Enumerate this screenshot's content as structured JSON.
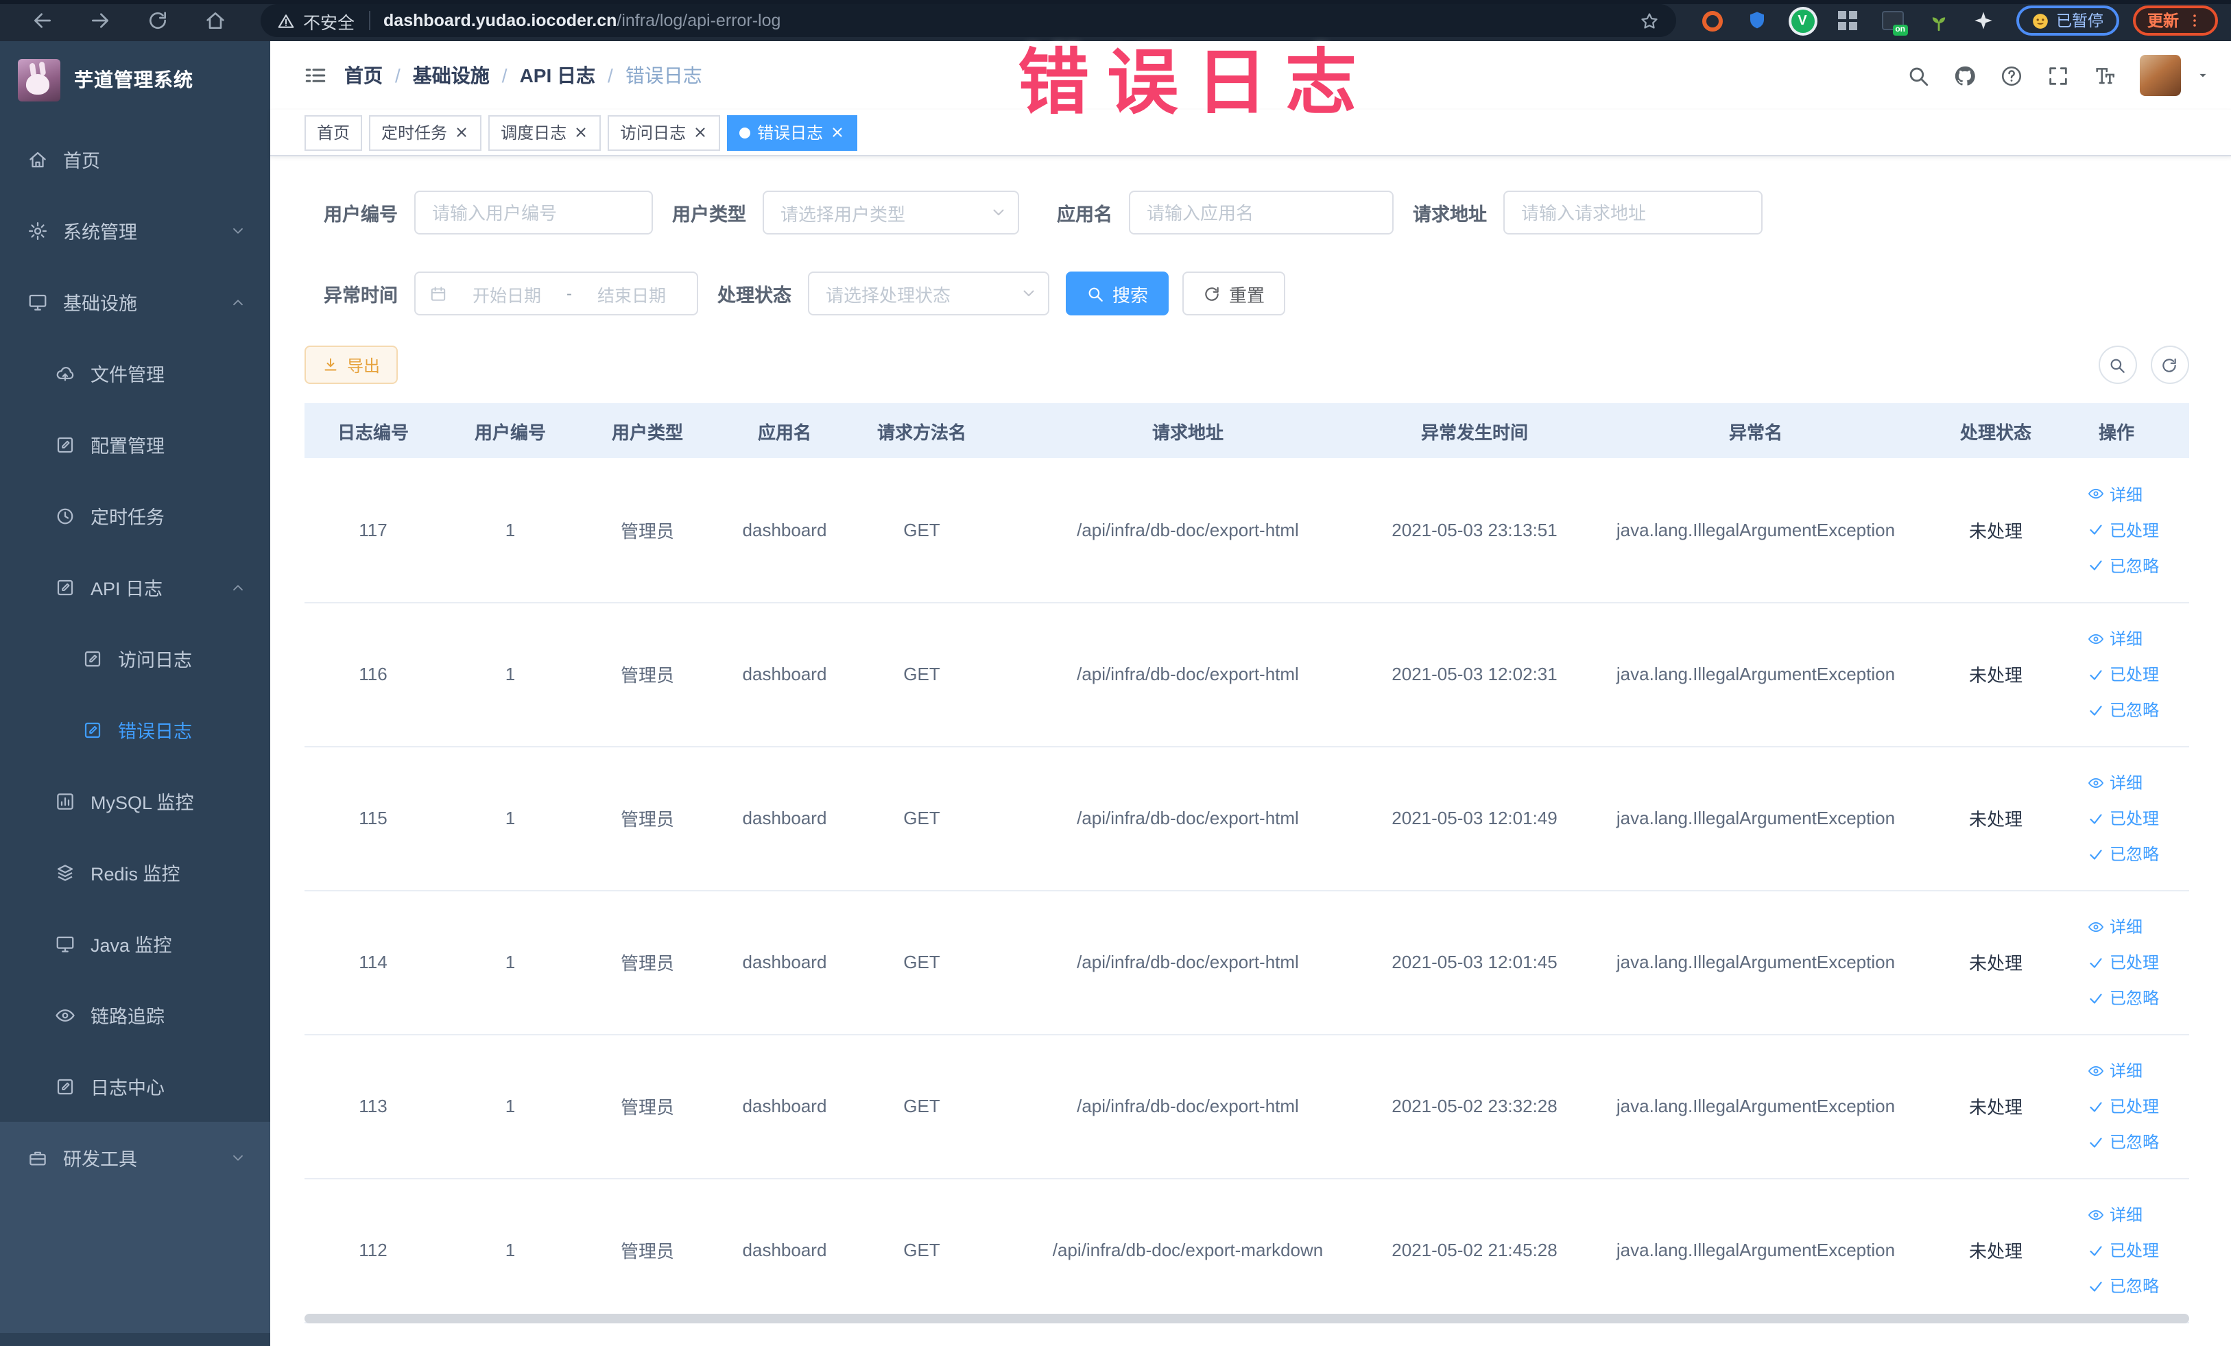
{
  "colors": {
    "accent": "#409eff",
    "warning": "#e6a23c",
    "sidebar_bg": "#2d4156",
    "annotation": "#f4426c",
    "table_header_bg": "#e9f1fb"
  },
  "annotation": {
    "text": "错误日志"
  },
  "browser": {
    "security": "不安全",
    "url_host": "dashboard.yudao.iocoder.cn",
    "url_path": "/infra/log/api-error-log",
    "ext_on_badge": "on",
    "ext_v_label": "V",
    "paused_label": "已暂停",
    "update_label": "更新"
  },
  "sidebar": {
    "title": "芋道管理系统",
    "items": [
      {
        "label": "首页",
        "icon": "home",
        "level": 0,
        "chevron": "",
        "active": false,
        "section": ""
      },
      {
        "label": "系统管理",
        "icon": "gear",
        "level": 0,
        "chevron": "down",
        "active": false,
        "section": ""
      },
      {
        "label": "基础设施",
        "icon": "monitor",
        "level": 0,
        "chevron": "up",
        "active": false,
        "section": ""
      },
      {
        "label": "文件管理",
        "icon": "cloud",
        "level": 1,
        "chevron": "",
        "active": false,
        "section": ""
      },
      {
        "label": "配置管理",
        "icon": "edit",
        "level": 1,
        "chevron": "",
        "active": false,
        "section": ""
      },
      {
        "label": "定时任务",
        "icon": "clock",
        "level": 1,
        "chevron": "",
        "active": false,
        "section": ""
      },
      {
        "label": "API 日志",
        "icon": "edit",
        "level": 1,
        "chevron": "up",
        "active": false,
        "section": ""
      },
      {
        "label": "访问日志",
        "icon": "edit",
        "level": 2,
        "chevron": "",
        "active": false,
        "section": ""
      },
      {
        "label": "错误日志",
        "icon": "edit",
        "level": 2,
        "chevron": "",
        "active": true,
        "section": ""
      },
      {
        "label": "MySQL 监控",
        "icon": "chart",
        "level": 1,
        "chevron": "",
        "active": false,
        "section": ""
      },
      {
        "label": "Redis 监控",
        "icon": "layers",
        "level": 1,
        "chevron": "",
        "active": false,
        "section": ""
      },
      {
        "label": "Java 监控",
        "icon": "monitor",
        "level": 1,
        "chevron": "",
        "active": false,
        "section": ""
      },
      {
        "label": "链路追踪",
        "icon": "eye",
        "level": 1,
        "chevron": "",
        "active": false,
        "section": ""
      },
      {
        "label": "日志中心",
        "icon": "edit",
        "level": 1,
        "chevron": "",
        "active": false,
        "section": ""
      },
      {
        "label": "研发工具",
        "icon": "toolbox",
        "level": 0,
        "chevron": "down",
        "active": false,
        "section": "light"
      }
    ]
  },
  "header": {
    "breadcrumb": [
      "首页",
      "基础设施",
      "API 日志",
      "错误日志"
    ],
    "separator": "/"
  },
  "tags": [
    {
      "label": "首页",
      "closable": false,
      "active": false
    },
    {
      "label": "定时任务",
      "closable": true,
      "active": false
    },
    {
      "label": "调度日志",
      "closable": true,
      "active": false
    },
    {
      "label": "访问日志",
      "closable": true,
      "active": false
    },
    {
      "label": "错误日志",
      "closable": true,
      "active": true
    }
  ],
  "filters": {
    "user_id": {
      "label": "用户编号",
      "placeholder": "请输入用户编号"
    },
    "user_type": {
      "label": "用户类型",
      "placeholder": "请选择用户类型"
    },
    "app_name": {
      "label": "应用名",
      "placeholder": "请输入应用名"
    },
    "request_url": {
      "label": "请求地址",
      "placeholder": "请输入请求地址"
    },
    "exception_time": {
      "label": "异常时间",
      "start_placeholder": "开始日期",
      "separator": "-",
      "end_placeholder": "结束日期"
    },
    "process_status": {
      "label": "处理状态",
      "placeholder": "请选择处理状态"
    },
    "search_label": "搜索",
    "reset_label": "重置"
  },
  "toolbar": {
    "export_label": "导出"
  },
  "table": {
    "headers": [
      "日志编号",
      "用户编号",
      "用户类型",
      "应用名",
      "请求方法名",
      "请求地址",
      "异常发生时间",
      "异常名",
      "处理状态",
      "操作"
    ],
    "actions": [
      {
        "label": "详细",
        "icon": "eye"
      },
      {
        "label": "已处理",
        "icon": "check"
      },
      {
        "label": "已忽略",
        "icon": "check"
      }
    ],
    "rows": [
      {
        "id": "117",
        "user_id": "1",
        "user_type": "管理员",
        "app": "dashboard",
        "method": "GET",
        "url": "/api/infra/db-doc/export-html",
        "time": "2021-05-03 23:13:51",
        "exception": "java.lang.IllegalArgumentException",
        "status": "未处理"
      },
      {
        "id": "116",
        "user_id": "1",
        "user_type": "管理员",
        "app": "dashboard",
        "method": "GET",
        "url": "/api/infra/db-doc/export-html",
        "time": "2021-05-03 12:02:31",
        "exception": "java.lang.IllegalArgumentException",
        "status": "未处理"
      },
      {
        "id": "115",
        "user_id": "1",
        "user_type": "管理员",
        "app": "dashboard",
        "method": "GET",
        "url": "/api/infra/db-doc/export-html",
        "time": "2021-05-03 12:01:49",
        "exception": "java.lang.IllegalArgumentException",
        "status": "未处理"
      },
      {
        "id": "114",
        "user_id": "1",
        "user_type": "管理员",
        "app": "dashboard",
        "method": "GET",
        "url": "/api/infra/db-doc/export-html",
        "time": "2021-05-03 12:01:45",
        "exception": "java.lang.IllegalArgumentException",
        "status": "未处理"
      },
      {
        "id": "113",
        "user_id": "1",
        "user_type": "管理员",
        "app": "dashboard",
        "method": "GET",
        "url": "/api/infra/db-doc/export-html",
        "time": "2021-05-02 23:32:28",
        "exception": "java.lang.IllegalArgumentException",
        "status": "未处理"
      },
      {
        "id": "112",
        "user_id": "1",
        "user_type": "管理员",
        "app": "dashboard",
        "method": "GET",
        "url": "/api/infra/db-doc/export-markdown",
        "time": "2021-05-02 21:45:28",
        "exception": "java.lang.IllegalArgumentException",
        "status": "未处理"
      }
    ]
  }
}
